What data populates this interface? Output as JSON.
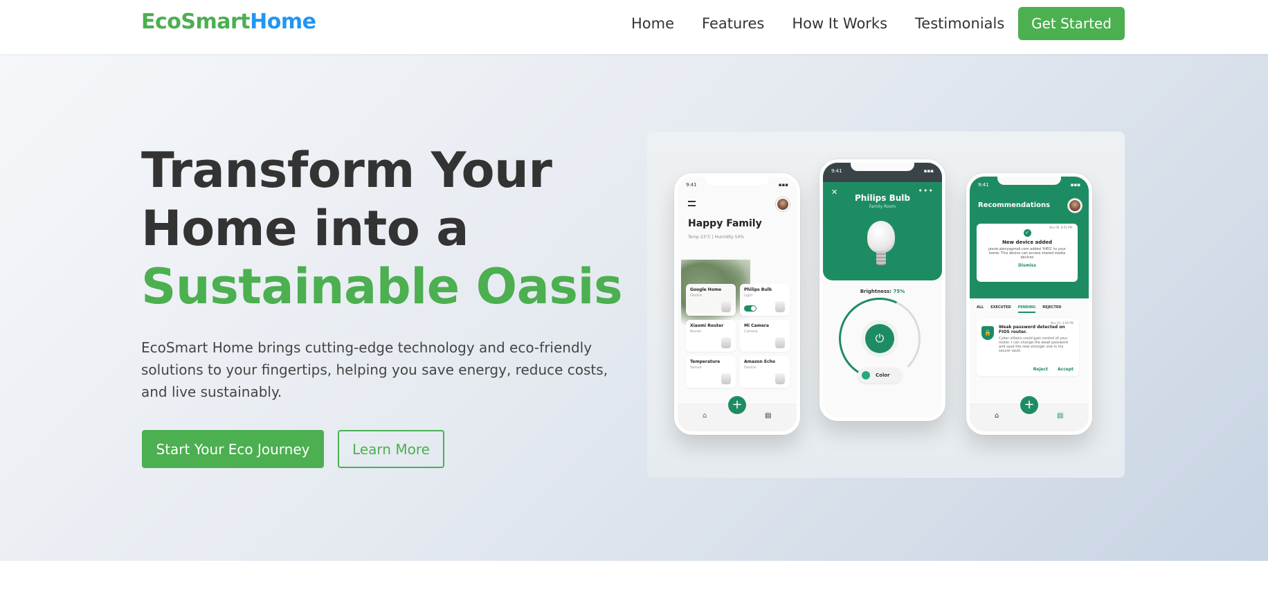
{
  "brand": {
    "part1": "EcoSmart",
    "part2": "Home"
  },
  "nav": {
    "links": [
      "Home",
      "Features",
      "How It Works",
      "Testimonials"
    ],
    "cta": "Get Started"
  },
  "hero": {
    "line1": "Transform Your",
    "line2": "Home into a",
    "line3": "Sustainable Oasis",
    "description": "EcoSmart Home brings cutting-edge technology and eco-friendly solutions to your fingertips, helping you save energy, reduce costs, and live sustainably.",
    "primary_cta": "Start Your Eco Journey",
    "secondary_cta": "Learn More"
  },
  "phone1": {
    "time": "9:41",
    "title": "Happy Family",
    "sub": "Temp 23°C  |  Humidity 54%",
    "devices": [
      {
        "name": "Google Home",
        "type": "Device"
      },
      {
        "name": "Philips Bulb",
        "type": "Light"
      },
      {
        "name": "Xiaomi Router",
        "type": "Router"
      },
      {
        "name": "Mi Camera",
        "type": "Camera"
      },
      {
        "name": "Temperature",
        "type": "Sensor"
      },
      {
        "name": "Amazon Echo",
        "type": "Device"
      }
    ],
    "fab": "+"
  },
  "phone2": {
    "time": "9:41",
    "name": "Philips Bulb",
    "room": "Family Room",
    "brightness_label": "Brightness:",
    "brightness_value": "75%",
    "color_label": "Color",
    "close": "✕",
    "more": "•••",
    "power": "⏻"
  },
  "phone3": {
    "time": "9:41",
    "title": "Recommendations",
    "notif_title": "New device added",
    "notif_body": "jessie.alenyagmail.com added 'HiEG' to your home. This device can access shared media devices",
    "notif_action": "Dismiss",
    "notif_date": "Nov 06, 8:05 PM",
    "tabs": [
      "ALL",
      "EXECUTED",
      "PENDING",
      "REJECTED"
    ],
    "alert_date": "Nov 03, 4:06 PM",
    "alert_title": "Weak password detected on FIOS router.",
    "alert_body": "Cyber villains could gain control of your router. I can change the weak password and save the new stronger one in my secure vault.",
    "reject": "Reject",
    "accept": "Accept",
    "fab": "+"
  },
  "colors": {
    "brand_green": "#4caf50",
    "brand_blue": "#2196f3",
    "app_green": "#1e8c63"
  },
  "icons": [
    "menu-icon",
    "home-icon",
    "document-icon",
    "plus-icon",
    "power-icon",
    "close-icon",
    "check-icon",
    "shield-icon",
    "more-icon"
  ]
}
